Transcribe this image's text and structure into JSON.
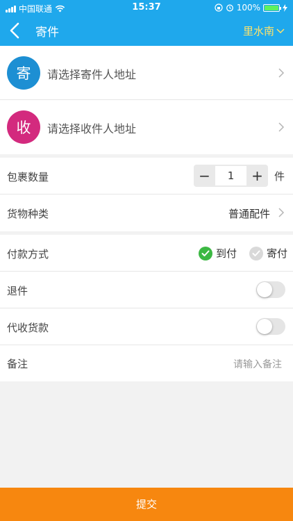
{
  "status_bar": {
    "carrier": "中国联通",
    "time": "15:37",
    "battery": "100%"
  },
  "nav": {
    "title": "寄件",
    "city": "里水南"
  },
  "sender": {
    "badge": "寄",
    "placeholder": "请选择寄件人地址",
    "color": "#1d8fd3"
  },
  "receiver": {
    "badge": "收",
    "placeholder": "请选择收件人地址",
    "color": "#d32a7e"
  },
  "package": {
    "label": "包裹数量",
    "quantity": "1",
    "minus": "−",
    "plus": "+",
    "unit": "件"
  },
  "goods": {
    "label": "货物种类",
    "value": "普通配件"
  },
  "payment": {
    "label": "付款方式",
    "options": [
      {
        "label": "到付",
        "selected": true
      },
      {
        "label": "寄付",
        "selected": false
      }
    ],
    "selected_color": "#3cb843",
    "unselected_color": "#d9d9d9"
  },
  "return": {
    "label": "退件",
    "on": false
  },
  "cod": {
    "label": "代收货款",
    "on": false
  },
  "remark": {
    "label": "备注",
    "placeholder": "请输入备注"
  },
  "submit": {
    "label": "提交"
  }
}
